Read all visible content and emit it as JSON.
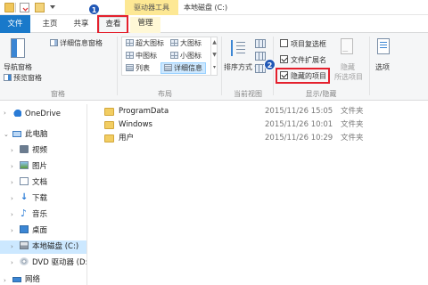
{
  "window": {
    "title": "本地磁盘 (C:)",
    "contextual_tab_group": "驱动器工具"
  },
  "tabs": {
    "file": "文件",
    "home": "主页",
    "share": "共享",
    "view": "查看",
    "manage": "管理"
  },
  "badges": {
    "step1": "1",
    "step2": "2"
  },
  "ribbon": {
    "panes": {
      "navigation_pane": "导航窗格",
      "preview_pane": "预览窗格",
      "details_pane": "详细信息窗格",
      "group_label": "窗格"
    },
    "layout": {
      "extra_large": "超大图标",
      "large": "大图标",
      "medium": "中图标",
      "small": "小图标",
      "list": "列表",
      "details": "详细信息",
      "group_label": "布局",
      "selected": "详细信息"
    },
    "current_view": {
      "sort_by": "排序方式",
      "group_label": "当前视图"
    },
    "show_hide": {
      "item_checkboxes": "项目复选框",
      "item_checkboxes_checked": false,
      "file_extensions": "文件扩展名",
      "file_extensions_checked": true,
      "hidden_items": "隐藏的项目",
      "hidden_items_checked": true,
      "hide_selected_line1": "隐藏",
      "hide_selected_line2": "所选项目",
      "group_label": "显示/隐藏"
    },
    "options": "选项"
  },
  "nav": {
    "items": [
      {
        "label": "OneDrive",
        "icon": "onedrive-icon"
      },
      {
        "label": "此电脑",
        "icon": "this-pc-icon"
      },
      {
        "label": "视频",
        "icon": "videos-icon"
      },
      {
        "label": "图片",
        "icon": "pictures-icon"
      },
      {
        "label": "文档",
        "icon": "documents-icon"
      },
      {
        "label": "下载",
        "icon": "downloads-icon"
      },
      {
        "label": "音乐",
        "icon": "music-icon"
      },
      {
        "label": "桌面",
        "icon": "desktop-icon"
      },
      {
        "label": "本地磁盘 (C:)",
        "icon": "drive-icon",
        "selected": true
      },
      {
        "label": "DVD 驱动器 (D:",
        "icon": "dvd-icon"
      },
      {
        "label": "网络",
        "icon": "network-icon"
      }
    ]
  },
  "files": [
    {
      "name": "ProgramData",
      "date": "2015/11/26 15:05",
      "type": "文件夹"
    },
    {
      "name": "Windows",
      "date": "2015/11/26 10:01",
      "type": "文件夹"
    },
    {
      "name": "用户",
      "date": "2015/11/26 10:29",
      "type": "文件夹"
    }
  ],
  "colors": {
    "file_tab": "#1979ca",
    "highlight_box": "#e4202d",
    "badge": "#2158b6",
    "contextual_band": "#fde894",
    "selection": "#cce8ff"
  }
}
